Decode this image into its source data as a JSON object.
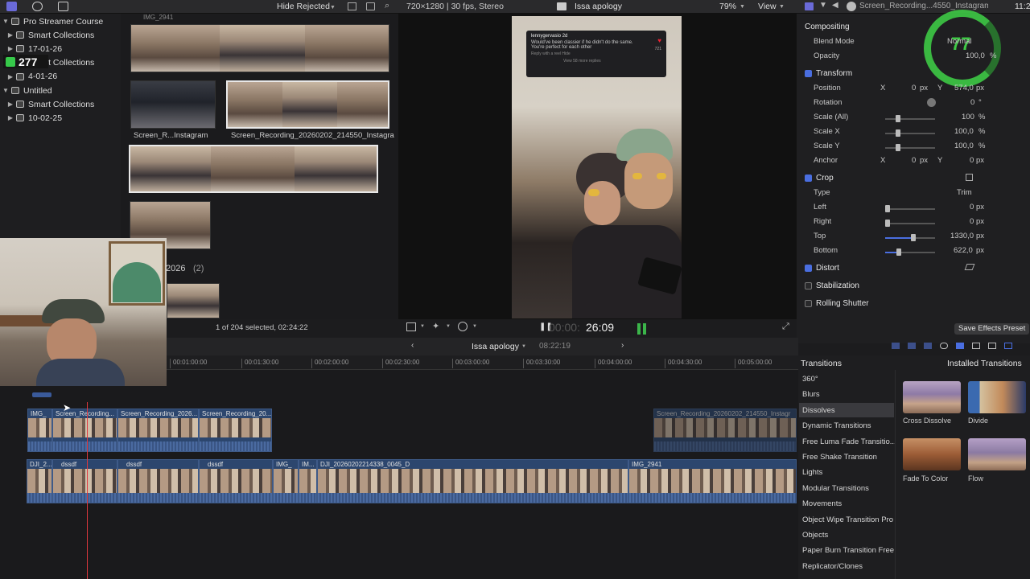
{
  "topbar": {
    "hide_rejected": "Hide Rejected",
    "video_format": "720×1280 | 30 fps, Stereo",
    "project_title": "Issa apology",
    "zoom": "79%",
    "view": "View",
    "inspector_clip_name": "Screen_Recording...4550_Instagram",
    "clock": "11:2"
  },
  "library": {
    "items": [
      {
        "label": "Pro Streamer Course",
        "level": 0
      },
      {
        "label": "Smart Collections",
        "level": 1
      },
      {
        "label": "17-01-26",
        "level": 1
      },
      {
        "label": "Smart Collections",
        "level": 1
      },
      {
        "label": "4-01-26",
        "level": 1
      },
      {
        "label": "Untitled",
        "level": 0
      },
      {
        "label": "Smart Collections",
        "level": 1
      },
      {
        "label": "10-02-25",
        "level": 1
      }
    ],
    "badge_count": "277"
  },
  "browser": {
    "clip_labels": [
      "Screen_R...Instagram",
      "Screen_Recording_20260202_214550_Instagra"
    ],
    "top_partial_label": "IMG_2941",
    "group_year": "2026",
    "group_count": "(2)",
    "status": "1 of 204 selected, 02:24:22"
  },
  "viewer": {
    "comment_user": "lennygervasio 2d",
    "comment_text": "Would've been classier if he didn't do the same. You're perfect for each other",
    "comment_likes": "721",
    "comment_reply": "Reply  with a reel   Hide",
    "comment_more": "View 58 more replies",
    "timecode_dim": "00:00:",
    "timecode": "26:09"
  },
  "inspector": {
    "compositing": "Compositing",
    "blend_mode_label": "Blend Mode",
    "blend_mode_value": "Normal",
    "opacity_label": "Opacity",
    "opacity_value": "100,0",
    "opacity_unit": "%",
    "transform": "Transform",
    "position_label": "Position",
    "position_x": "0",
    "position_y": "574,0",
    "rotation_label": "Rotation",
    "rotation_value": "0",
    "scale_all_label": "Scale (All)",
    "scale_all_value": "100",
    "scale_x_label": "Scale X",
    "scale_x_value": "100,0",
    "scale_y_label": "Scale Y",
    "scale_y_value": "100,0",
    "anchor_label": "Anchor",
    "anchor_x": "0",
    "anchor_y": "0",
    "crop": "Crop",
    "type_label": "Type",
    "type_value": "Trim",
    "left_label": "Left",
    "left_value": "0",
    "right_label": "Right",
    "right_value": "0",
    "top_label": "Top",
    "top_value": "1330,0",
    "bottom_label": "Bottom",
    "bottom_value": "622,0",
    "distort": "Distort",
    "stabilization": "Stabilization",
    "rolling_shutter": "Rolling Shutter",
    "save_preset": "Save Effects Preset",
    "unit_px": "px",
    "unit_pct": "%",
    "unit_deg": "°",
    "axis_x": "X",
    "axis_y": "Y",
    "overlay_number": "77"
  },
  "timeline": {
    "project": "Issa apology",
    "duration": "08:22:19",
    "ruler": [
      "00:01:00:00",
      "00:01:30:00",
      "00:02:00:00",
      "00:02:30:00",
      "00:03:00:00",
      "00:03:30:00",
      "00:04:00:00",
      "00:04:30:00",
      "00:05:00:00"
    ],
    "upper_clips": [
      "IMG_",
      "Screen_Recording...",
      "Screen_Recording_2026...",
      "Screen_Recording_20...",
      "Screen_Recording_20260202_214550_Instagr"
    ],
    "main_clips": [
      "DJI_2...",
      "dssdf",
      "dssdf",
      "dssdf",
      "IMG_",
      "IM...",
      "DJI_20260202214338_0045_D",
      "IMG_2941"
    ]
  },
  "transitions": {
    "title": "Transitions",
    "installed": "Installed Transitions",
    "categories": [
      "360°",
      "Blurs",
      "Dissolves",
      "Dynamic Transitions",
      "Free Luma Fade Transitio...",
      "Free Shake Transition",
      "Lights",
      "Modular Transitions",
      "Movements",
      "Object Wipe Transition Pro",
      "Objects",
      "Paper Burn Transition Free",
      "Replicator/Clones"
    ],
    "selected": "Dissolves",
    "thumbs": [
      "Cross Dissolve",
      "Divide",
      "Fade To Color",
      "Flow"
    ]
  }
}
